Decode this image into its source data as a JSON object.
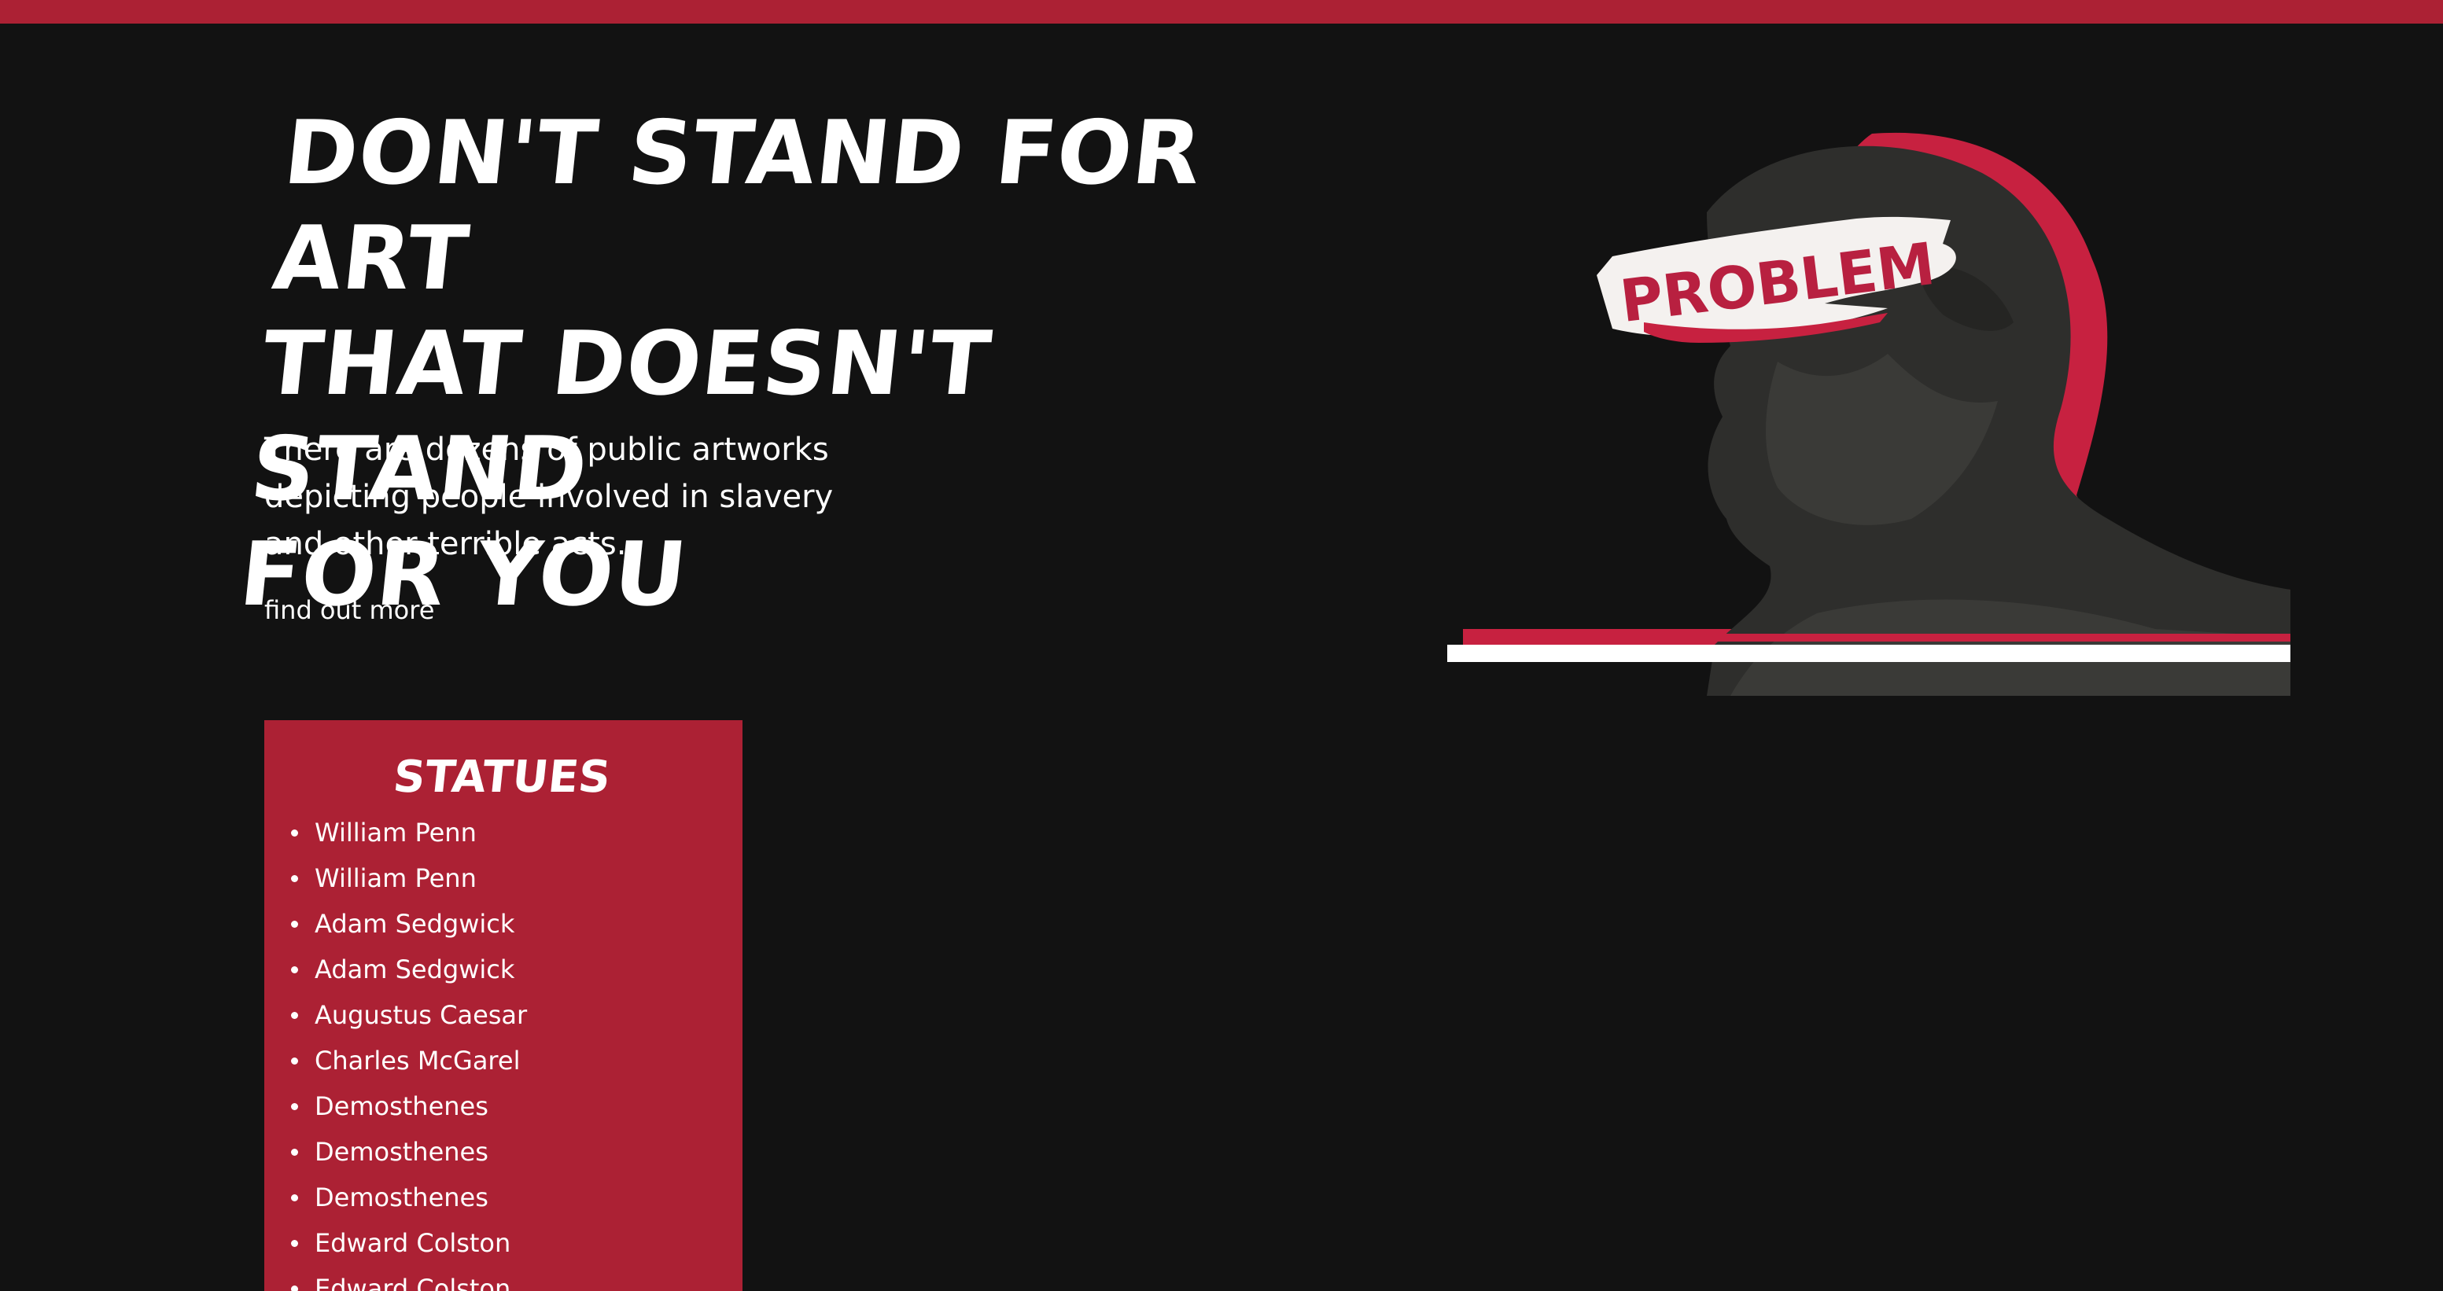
{
  "colors": {
    "accent": "#ac2134",
    "background": "#121212",
    "text": "#ffffff"
  },
  "hero": {
    "title_line1": "Don't stand for art",
    "title_line2": "that doesn't stand",
    "title_line3": "for you",
    "subtitle": "There are dozens of public artworks depicting people involved in slavery and other terrible acts.",
    "link_label": "find out more",
    "image_label": "PROBLEM"
  },
  "statues": {
    "heading": "Statues",
    "items": [
      "William Penn",
      "William Penn",
      "Adam Sedgwick",
      "Adam Sedgwick",
      "Augustus Caesar",
      "Charles McGarel",
      "Demosthenes",
      "Demosthenes",
      "Demosthenes",
      "Edward Colston",
      "Edward Colston"
    ]
  }
}
